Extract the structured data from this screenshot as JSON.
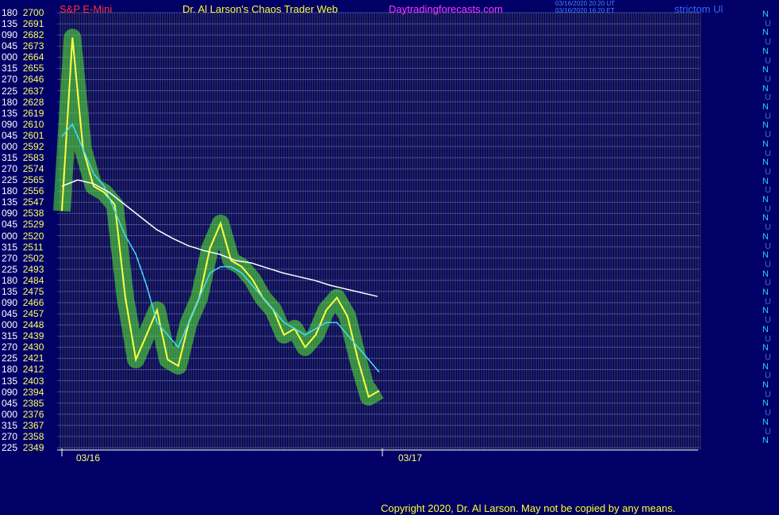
{
  "header": {
    "symbol": "S&P E-Mini",
    "title": "Dr. Al Larson's Chaos Trader Web",
    "site": "Daytradingforecasts.com",
    "stamp_line1": "03/16/2020 20:20 UT",
    "stamp_line2": "03/16/2020 16:20 ET",
    "right_tag": "strictom Ul"
  },
  "colors": {
    "background": "#000066",
    "price_labels": "#ffff66",
    "angle_labels": "#ffffff",
    "symbol": "#ff3333",
    "title": "#ffff33",
    "site": "#ff33ff",
    "price_line": "#ffff44",
    "avg_line": "#ffffff",
    "cyan_line": "#44ddff",
    "green_glow": "#55ee33"
  },
  "chart_data": {
    "type": "line",
    "title": "S&P E-Mini",
    "x_dates": [
      "03/16",
      "03/17"
    ],
    "ylim": [
      2349,
      2700
    ],
    "price_ladder": [
      {
        "angle": "180",
        "price": 2700
      },
      {
        "angle": "135",
        "price": 2691
      },
      {
        "angle": "090",
        "price": 2682
      },
      {
        "angle": "045",
        "price": 2673
      },
      {
        "angle": "000",
        "price": 2664
      },
      {
        "angle": "315",
        "price": 2655
      },
      {
        "angle": "270",
        "price": 2646
      },
      {
        "angle": "225",
        "price": 2637
      },
      {
        "angle": "180",
        "price": 2628
      },
      {
        "angle": "135",
        "price": 2619
      },
      {
        "angle": "090",
        "price": 2610
      },
      {
        "angle": "045",
        "price": 2601
      },
      {
        "angle": "000",
        "price": 2592
      },
      {
        "angle": "315",
        "price": 2583
      },
      {
        "angle": "270",
        "price": 2574
      },
      {
        "angle": "225",
        "price": 2565
      },
      {
        "angle": "180",
        "price": 2556
      },
      {
        "angle": "135",
        "price": 2547
      },
      {
        "angle": "090",
        "price": 2538
      },
      {
        "angle": "045",
        "price": 2529
      },
      {
        "angle": "000",
        "price": 2520
      },
      {
        "angle": "315",
        "price": 2511
      },
      {
        "angle": "270",
        "price": 2502
      },
      {
        "angle": "225",
        "price": 2493
      },
      {
        "angle": "180",
        "price": 2484
      },
      {
        "angle": "135",
        "price": 2475
      },
      {
        "angle": "090",
        "price": 2466
      },
      {
        "angle": "045",
        "price": 2457
      },
      {
        "angle": "000",
        "price": 2448
      },
      {
        "angle": "315",
        "price": 2439
      },
      {
        "angle": "270",
        "price": 2430
      },
      {
        "angle": "225",
        "price": 2421
      },
      {
        "angle": "180",
        "price": 2412
      },
      {
        "angle": "135",
        "price": 2403
      },
      {
        "angle": "090",
        "price": 2394
      },
      {
        "angle": "045",
        "price": 2385
      },
      {
        "angle": "000",
        "price": 2376
      },
      {
        "angle": "315",
        "price": 2367
      },
      {
        "angle": "270",
        "price": 2358
      },
      {
        "angle": "225",
        "price": 2349
      }
    ],
    "series": [
      {
        "color": "#ffff44",
        "values": [
          2540,
          2680,
          2590,
          2560,
          2555,
          2545,
          2470,
          2420,
          2440,
          2460,
          2420,
          2415,
          2450,
          2470,
          2510,
          2530,
          2500,
          2495,
          2485,
          2470,
          2460,
          2440,
          2445,
          2430,
          2440,
          2460,
          2470,
          2455,
          2420,
          2390,
          2395
        ]
      },
      {
        "color": "#44ddff",
        "values": [
          2600,
          2610,
          2590,
          2570,
          2560,
          2540,
          2520,
          2505,
          2480,
          2450,
          2440,
          2430,
          2450,
          2470,
          2490,
          2495,
          2495,
          2490,
          2480,
          2470,
          2460,
          2450,
          2445,
          2440,
          2445,
          2450,
          2450,
          2440,
          2430,
          2420,
          2410
        ]
      },
      {
        "color": "#ffffff",
        "values": [
          2560,
          2565,
          2562,
          2555,
          2545,
          2535,
          2525,
          2518,
          2512,
          2508,
          2505,
          2500,
          2498,
          2494,
          2490,
          2487,
          2484,
          2480,
          2477,
          2474,
          2471
        ]
      }
    ]
  },
  "right_column": [
    "N",
    "U",
    "N",
    "U",
    "N",
    "U",
    "N",
    "U",
    "N",
    "U",
    "N",
    "U",
    "N",
    "U",
    "N",
    "U",
    "N",
    "U",
    "N",
    "U",
    "N",
    "U",
    "N",
    "U",
    "N",
    "U",
    "N",
    "U",
    "N",
    "U",
    "N",
    "U",
    "N",
    "U",
    "N",
    "U",
    "N",
    "U",
    "N",
    "U",
    "N",
    "U",
    "N",
    "U",
    "N",
    "U",
    "N"
  ],
  "footer": {
    "copyright": "Copyright 2020, Dr. Al Larson. May not be copied by any means."
  }
}
